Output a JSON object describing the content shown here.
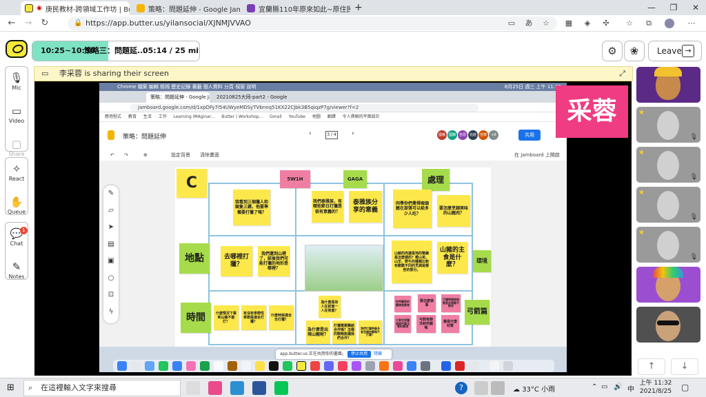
{
  "browser": {
    "tabs": [
      {
        "title": "庚民教材-跨領域工作坊 | Bu",
        "favicon_color": "#f5e83c",
        "active": true
      },
      {
        "title": "策略：問題延伸 - Google Jambo",
        "favicon_color": "#f4b400",
        "active": false
      },
      {
        "title": "宜蘭縣110年原來如此~原住民族",
        "favicon_color": "#7b3fb5",
        "active": false
      }
    ],
    "new_tab": "+",
    "url": "https://app.butter.us/yilansocial/XJNMJVVAO",
    "window_buttons": [
      "—",
      "❐",
      "✕"
    ]
  },
  "butter": {
    "agenda_time": "10:25~10:50",
    "agenda_title": "策略三：問題延...",
    "agenda_clock": "05:14 / 25 mins",
    "leave_label": "Leave",
    "rail": {
      "mic": "Mic",
      "video": "Video",
      "share": "Share",
      "react": "React",
      "queue": "Queue",
      "chat": "Chat",
      "chat_badge": "1",
      "notes": "Notes"
    },
    "banner": "李采蓉 is sharing their screen",
    "name_tag": "采蓉",
    "tiles": [
      {
        "bg": "#5b2a86",
        "star": false,
        "mic_off": false
      },
      {
        "bg": "#9a9a9a",
        "star": true,
        "mic_off": true
      },
      {
        "bg": "#9a9a9a",
        "star": true,
        "mic_off": true
      },
      {
        "bg": "#9a9a9a",
        "star": true,
        "mic_off": true
      },
      {
        "bg": "#9a9a9a",
        "star": true,
        "mic_off": true
      },
      {
        "bg": "#9b4fd0",
        "star": false,
        "mic_off": false
      },
      {
        "bg": "#505050",
        "star": false,
        "mic_off": false
      }
    ],
    "scroll_up": "↑",
    "scroll_down": "↓"
  },
  "shared": {
    "menu": "Chrome  檔案  編輯  檢視  歷史記錄  書籤  個人資料  分頁  視窗  說明",
    "menu_right": "8月25日 週三 上午 11:32",
    "tab1": "策略：問題延伸 - Google Jamb",
    "tab2": "20210825大同-part2 - Google Jamb",
    "url": "jamboard.google.com/d/1xpDFy7I54UWyeMDSyTVbnnq51KX22CJbk3B5qiqzP7g/viewer?f=2",
    "bookmarks": [
      "應用程式",
      "教育",
      "生活",
      "工作",
      "Learning IMAginar...",
      "Butter | Workshop...",
      "Gmail",
      "YouTube",
      "地圖",
      "翻譯",
      "令人費解的平面設計"
    ],
    "jam_title": "策略：問題延伸",
    "frame": "3 / 4",
    "share_label": "共用",
    "set_bg": "設定背景",
    "clear": "清除畫面",
    "open_in": "在 Jamboard 上開啟",
    "share_notice": "app.butter.us 正在共用你的畫面。",
    "stop_share": "停止共用",
    "hide": "隱藏",
    "avatars": [
      {
        "label": "國義",
        "color": "#c0392b"
      },
      {
        "label": "國錦",
        "color": "#16a085"
      },
      {
        "label": "吉恩",
        "color": "#8e44ad"
      },
      {
        "label": "兆鈺",
        "color": "#2c3e50"
      },
      {
        "label": "佳鋒",
        "color": "#d35400"
      },
      {
        "label": "+8",
        "color": "#7f8c8d"
      }
    ],
    "board": {
      "c": "C",
      "w": "5W1H",
      "gaga": "GAGA",
      "handle": "處理",
      "place": "地點",
      "time": "時間",
      "env": "環境",
      "arrow": "弓箭篇",
      "n1": "我看到三個獵人和兩隻三鏢，他要準備要打獵了嗎？",
      "n2": "我們泰雅族，有哪些節日打獵是很有意義的？",
      "n3": "泰雅族分享的意義",
      "n4": "同學你們覺得兩頭豬在部落可以給多少人吃？",
      "n5": "要怎麼烹調美味的山豬肉？",
      "n6": "去哪裡打獵？",
      "n7": "我們還到山裡了，該後我們可能打獵的地形是哪裡？",
      "n8": "山豬的肉還是地的整鍊是怎麼樣的？需山羌、山羊、野牛的種類比較有歡歡不同的烹調是哪些的部分。",
      "n9": "山豬的主食是什麼？",
      "n10": "什麼情況下看到山豬不能打？",
      "n11": "有沒有季節性季節是適合打獵？",
      "n12": "什麼時候適合去打獵？",
      "n13": "為什麼是有人在前面一人在後面？",
      "n14": "為什麼是出現山豬呢？",
      "n15": "打獵需要團結合作嗎？怎樣的戰略能讓我們合作？",
      "n16": "我們打獵時最多會怎樣的戰略不打獵？",
      "n17": "吃完獵到的獵物後要會",
      "n18": "要怎麼做事",
      "n19": "打獵時最後後要是否想要不殺去",
      "n20": "大家在狩獵過程中要注意的事項",
      "n21": "弓箭有辦法射死豬嗎",
      "n22": "最是什麼材質"
    }
  },
  "taskbar": {
    "search": "在這裡輸入文字來搜尋",
    "weather": "33°C 小雨",
    "ime": "中",
    "time": "上午 11:32",
    "date": "2021/8/25"
  }
}
